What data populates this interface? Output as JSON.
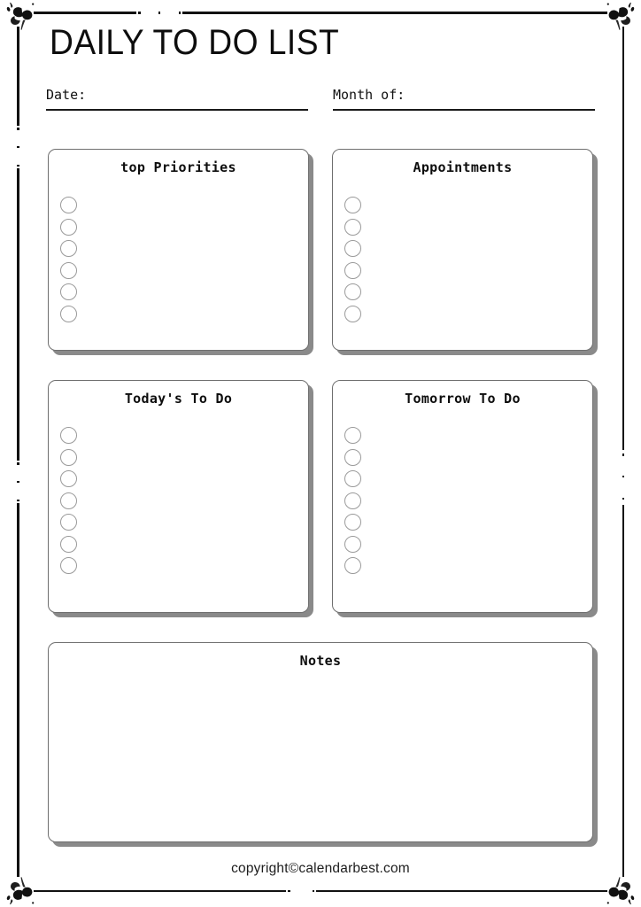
{
  "document": {
    "title": "DAILY TO DO LIST"
  },
  "fields": [
    {
      "label": "Date:",
      "value": ""
    },
    {
      "label": "Month of:",
      "value": ""
    }
  ],
  "cards": [
    {
      "id": "top-priorities",
      "title": "top Priorities",
      "checkbox_count": 6
    },
    {
      "id": "appointments",
      "title": "Appointments",
      "checkbox_count": 6
    },
    {
      "id": "today-todo",
      "title": "Today's To Do",
      "checkbox_count": 7
    },
    {
      "id": "tomorrow-todo",
      "title": "Tomorrow To Do",
      "checkbox_count": 7
    },
    {
      "id": "notes",
      "title": "Notes",
      "checkbox_count": 0
    }
  ],
  "footer": {
    "credit": "copyright©calendarbest.com"
  },
  "decoration": {
    "corner_ornament": "floral-leaf-ornament",
    "border_color": "#111111",
    "card_border_color": "#6f6f6f",
    "card_shadow_color": "#8a8a8a",
    "checkbox_border_color": "#9a9a9a"
  }
}
